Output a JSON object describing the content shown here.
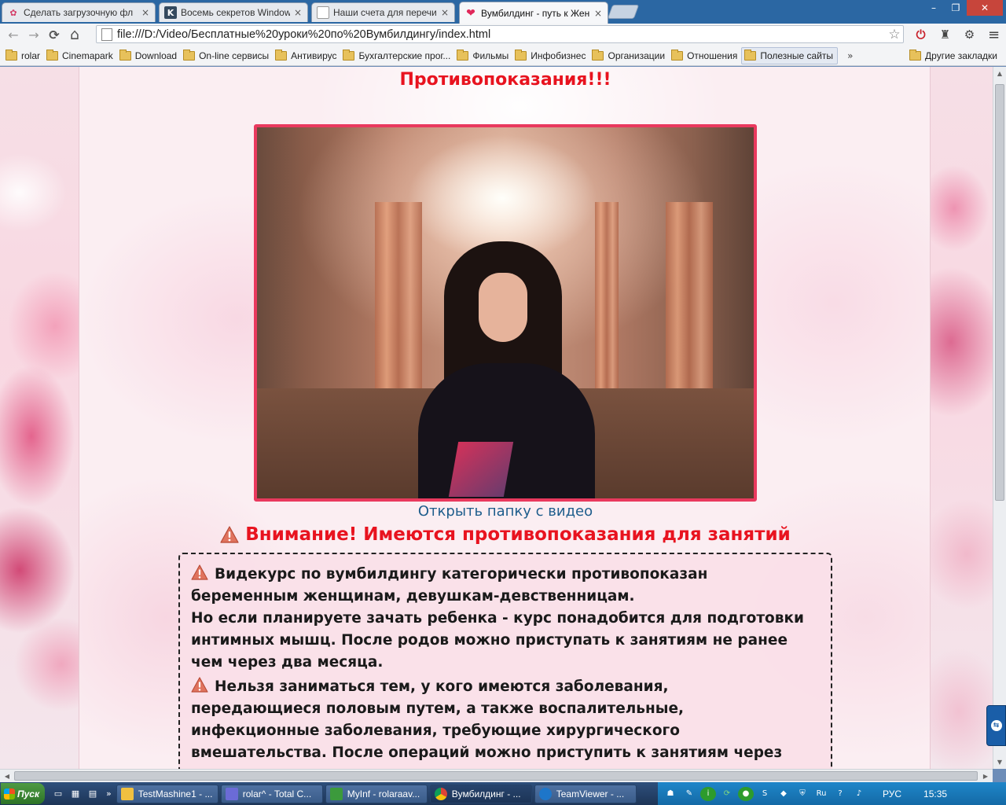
{
  "browser": {
    "tabs": [
      {
        "title": "Сделать загрузочную фл",
        "close": "×",
        "icon": "flower-favicon-icon",
        "color": "#d43d67"
      },
      {
        "title": "Восемь секретов Window",
        "close": "×",
        "icon": "k-favicon-icon",
        "color": "#34495e"
      },
      {
        "title": "Наши счета для перечис",
        "close": "×",
        "icon": "page-favicon-icon",
        "color": "#ffffff"
      },
      {
        "title": "Вумбилдинг - путь к Жен",
        "close": "×",
        "icon": "heart-favicon-icon",
        "color": "#e0285a",
        "active": true
      }
    ],
    "window_buttons": {
      "minimize": "–",
      "maximize": "❐",
      "close": "✕"
    },
    "toolbar": {
      "back": "←",
      "forward": "→",
      "reload": "⟳",
      "home": "⌂",
      "url": "file:///D:/Video/Бесплатные%20уроки%20по%20Вумбилдингу/index.html",
      "star": "☆",
      "extensions": [
        "⏻",
        "♜",
        "⚙",
        "≡"
      ]
    },
    "bookmarks": [
      {
        "label": "rolar"
      },
      {
        "label": "Cinemapark"
      },
      {
        "label": "Download"
      },
      {
        "label": "On-line сервисы"
      },
      {
        "label": "Антивирус"
      },
      {
        "label": "Бухгалтерские прог..."
      },
      {
        "label": "Фильмы"
      },
      {
        "label": "Инфобизнес"
      },
      {
        "label": "Организации"
      },
      {
        "label": "Отношения"
      },
      {
        "label": "Полезные сайты",
        "highlight": true
      }
    ],
    "bookmarks_more": "»",
    "other_bookmarks": "Другие закладки"
  },
  "page": {
    "title": "Противопоказания!!!",
    "video_link": "Открыть папку с видео",
    "warning_heading": "Внимание! Имеются противопоказания для занятий",
    "warning_paragraphs": [
      {
        "lines": [
          "Видекурс по вумбилдингу категорически противопоказан",
          "беременным женщинам, девушкам-девственницам.",
          "Но если планируете зачать ребенка - курс понадобится для подготовки",
          "интимных мышц. После родов можно приступать к занятиям не ранее",
          "чем через два месяца."
        ]
      },
      {
        "lines": [
          "Нельзя заниматься тем, у кого имеются заболевания,",
          "передающиеся половым путем, а также воспалительные,",
          "инфекционные заболевания, требующие хирургического",
          "вмешательства. После операций можно приступить к занятиям через"
        ]
      }
    ],
    "accent_color": "#e8131f",
    "frame_color": "#e9395e"
  },
  "scrollbars": {
    "up": "▲",
    "down": "▼",
    "left": "◀",
    "right": "▶"
  },
  "taskbar": {
    "start_label": "Пуск",
    "quicklaunch_more": "»",
    "tasks": [
      {
        "label": "TestMashine1 - ...",
        "color": "#f0c040"
      },
      {
        "label": "rolar^ - Total C...",
        "color": "#6b6bd6"
      },
      {
        "label": "MyInf - rolaraav...",
        "color": "#3c9a3c"
      },
      {
        "label": "Вумбилдинг - ...",
        "color": "#e2b12b",
        "active": true
      },
      {
        "label": "TeamViewer - ...",
        "color": "#1e76c9"
      }
    ],
    "tray_language": "РУС",
    "clock": "15:35",
    "tray_ru": "Ru"
  }
}
